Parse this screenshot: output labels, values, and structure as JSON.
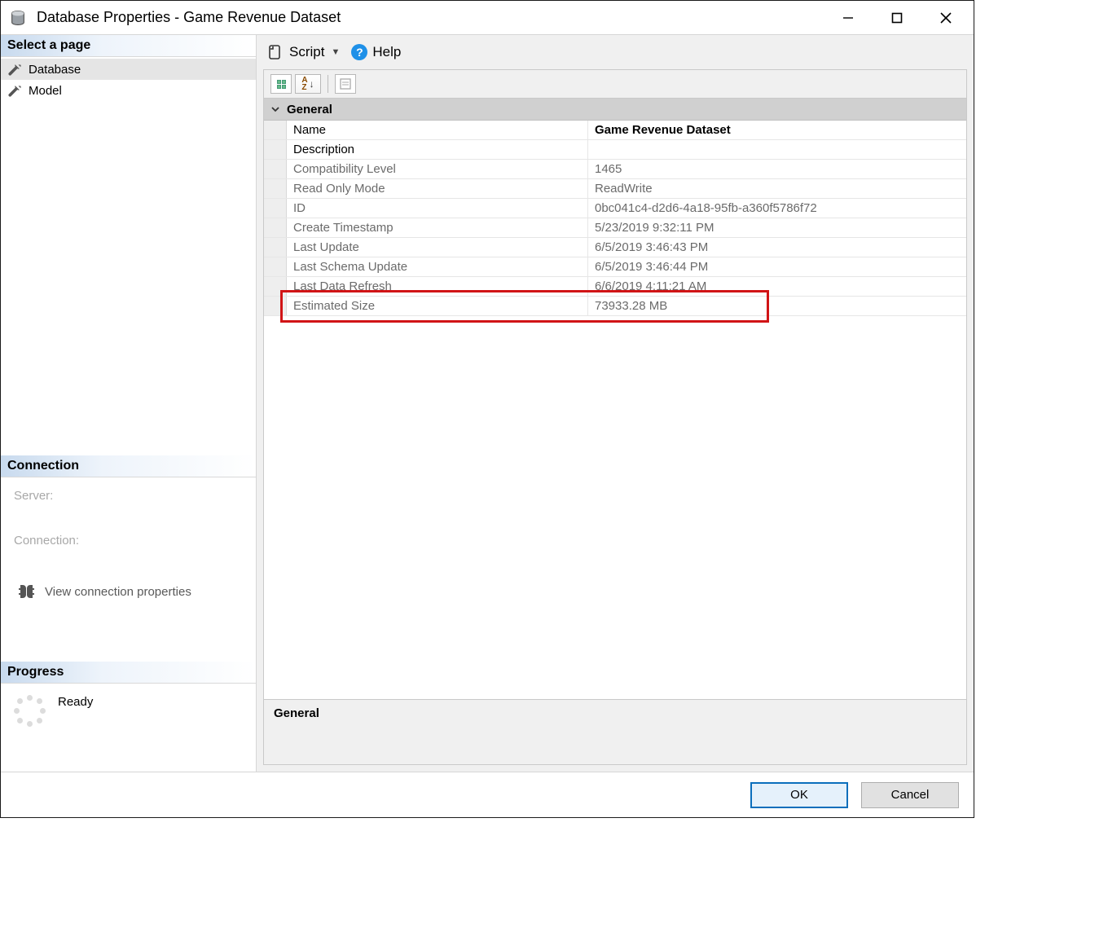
{
  "window": {
    "title": "Database Properties - Game Revenue Dataset"
  },
  "sidebar": {
    "select_page_header": "Select a page",
    "items": [
      {
        "label": "Database",
        "selected": true
      },
      {
        "label": "Model",
        "selected": false
      }
    ],
    "connection_header": "Connection",
    "server_label": "Server:",
    "connection_label": "Connection:",
    "view_conn_props": "View connection properties",
    "progress_header": "Progress",
    "progress_status": "Ready"
  },
  "toolbar": {
    "script_label": "Script",
    "help_label": "Help"
  },
  "grid": {
    "group_label": "General",
    "rows": [
      {
        "label": "Name",
        "value": "Game Revenue Dataset",
        "readonly": false,
        "bold": true
      },
      {
        "label": "Description",
        "value": "",
        "readonly": false,
        "bold": false
      },
      {
        "label": "Compatibility Level",
        "value": "1465",
        "readonly": true,
        "bold": false
      },
      {
        "label": "Read Only Mode",
        "value": "ReadWrite",
        "readonly": true,
        "bold": false
      },
      {
        "label": "ID",
        "value": "0bc041c4-d2d6-4a18-95fb-a360f5786f72",
        "readonly": true,
        "bold": false
      },
      {
        "label": "Create Timestamp",
        "value": "5/23/2019 9:32:11 PM",
        "readonly": true,
        "bold": false
      },
      {
        "label": "Last Update",
        "value": "6/5/2019 3:46:43 PM",
        "readonly": true,
        "bold": false
      },
      {
        "label": "Last Schema Update",
        "value": "6/5/2019 3:46:44 PM",
        "readonly": true,
        "bold": false
      },
      {
        "label": "Last Data Refresh",
        "value": "6/6/2019 4:11:21 AM",
        "readonly": true,
        "bold": false
      },
      {
        "label": "Estimated Size",
        "value": "73933.28 MB",
        "readonly": true,
        "bold": false
      }
    ],
    "description_label": "General"
  },
  "footer": {
    "ok_label": "OK",
    "cancel_label": "Cancel"
  }
}
